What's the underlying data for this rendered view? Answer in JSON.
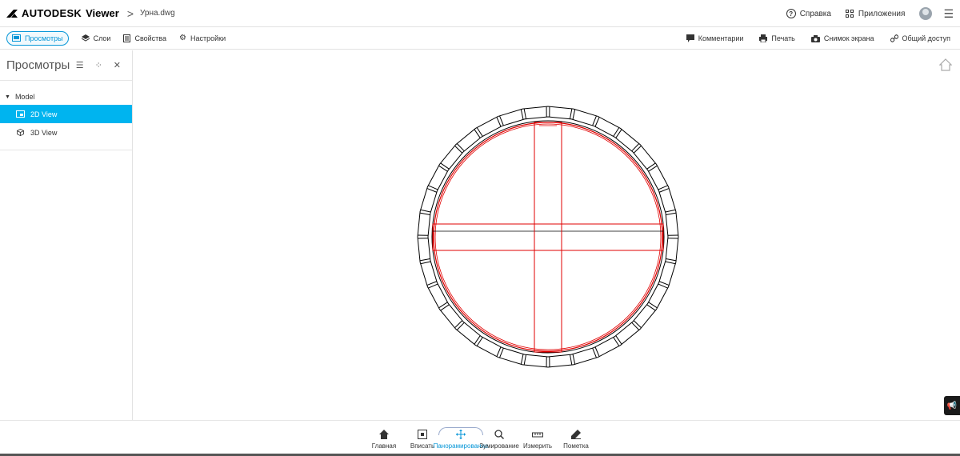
{
  "app": {
    "brand": "AUTODESK",
    "product": "Viewer",
    "breadcrumb_sep": ">",
    "filename": "Урна.dwg"
  },
  "top_right": {
    "help_label": "Справка",
    "apps_label": "Приложения"
  },
  "toolbar": {
    "left": [
      {
        "label": "Просмотры",
        "icon": "views-icon",
        "active": true
      },
      {
        "label": "Слои",
        "icon": "layers-icon"
      },
      {
        "label": "Свойства",
        "icon": "properties-icon"
      },
      {
        "label": "Настройки",
        "icon": "gear-icon"
      }
    ],
    "right": [
      {
        "label": "Комментарии",
        "icon": "comment-icon"
      },
      {
        "label": "Печать",
        "icon": "print-icon"
      },
      {
        "label": "Снимок экрана",
        "icon": "camera-icon"
      },
      {
        "label": "Общий доступ",
        "icon": "share-link-icon"
      }
    ]
  },
  "sidebar": {
    "title": "Просмотры",
    "tree_root": "Model",
    "items": [
      {
        "label": "2D View",
        "icon": "2d-view-icon",
        "selected": true
      },
      {
        "label": "3D View",
        "icon": "3d-cube-icon",
        "selected": false
      }
    ]
  },
  "bottom_toolbar": {
    "items": [
      {
        "label": "Главная",
        "icon": "home-icon"
      },
      {
        "label": "Вписать",
        "icon": "fit-icon"
      },
      {
        "label": "Панорамирование",
        "icon": "pan-icon",
        "active": true
      },
      {
        "label": "Зумирование",
        "icon": "zoom-icon"
      },
      {
        "label": "Измерить",
        "icon": "measure-icon"
      },
      {
        "label": "Пометка",
        "icon": "markup-icon"
      }
    ]
  },
  "colors": {
    "accent": "#0696d7",
    "selection": "#00b4ef",
    "drawing_red": "#e00000",
    "drawing_black": "#000000"
  }
}
